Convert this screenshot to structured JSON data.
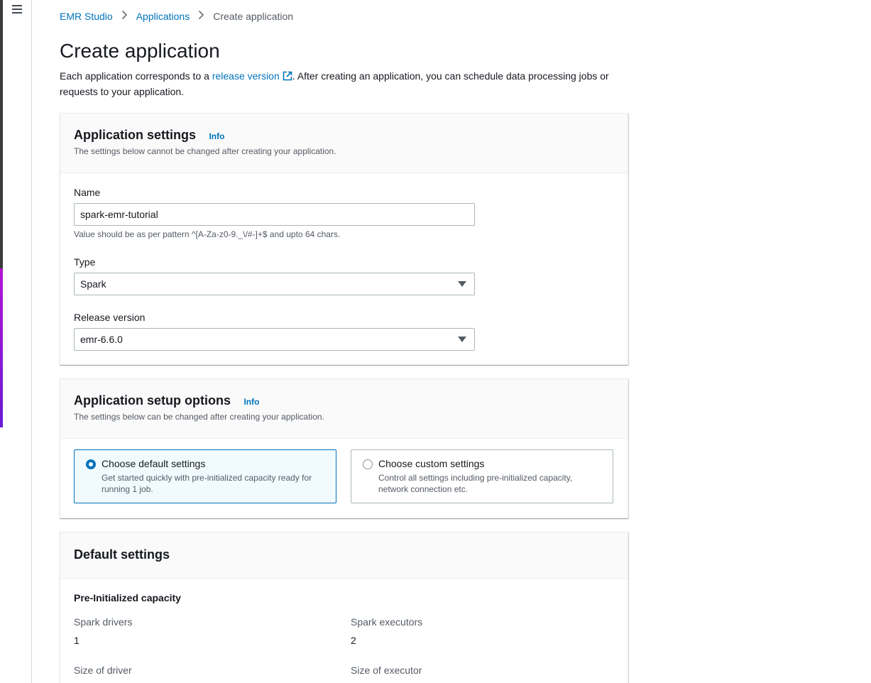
{
  "nav": {
    "menu_icon": "hamburger-menu-icon"
  },
  "breadcrumb": {
    "items": [
      "EMR Studio",
      "Applications"
    ],
    "current": "Create application",
    "separator_icon": "chevron-right-icon"
  },
  "header": {
    "title": "Create application",
    "description_prefix": "Each application corresponds to a ",
    "description_link": "release version",
    "description_suffix": ". After creating an application, you can schedule data processing jobs or requests to your application.",
    "link_icon": "external-link-icon"
  },
  "application_settings": {
    "title": "Application settings",
    "info": "Info",
    "subtitle": "The settings below cannot be changed after creating your application.",
    "name_label": "Name",
    "name_value": "spark-emr-tutorial",
    "name_constraint": "Value should be as per pattern ^[A-Za-z0-9._\\/#-]+$ and upto 64 chars.",
    "type_label": "Type",
    "type_value": "Spark",
    "release_label": "Release version",
    "release_value": "emr-6.6.0"
  },
  "setup_options": {
    "title": "Application setup options",
    "info": "Info",
    "subtitle": "The settings below can be changed after creating your application.",
    "options": [
      {
        "title": "Choose default settings",
        "description": "Get started quickly with pre-initialized capacity ready for running 1 job.",
        "selected": true
      },
      {
        "title": "Choose custom settings",
        "description": "Control all settings including pre-initialized capacity, network connection etc.",
        "selected": false
      }
    ]
  },
  "default_settings": {
    "title": "Default settings",
    "section": "Pre-Initialized capacity",
    "spark_drivers_label": "Spark drivers",
    "spark_drivers_value": "1",
    "spark_executors_label": "Spark executors",
    "spark_executors_value": "2",
    "size_driver_label": "Size of driver",
    "size_executor_label": "Size of executor"
  },
  "colors": {
    "link": "#0073bb",
    "accent_purple": "#b314d6"
  }
}
